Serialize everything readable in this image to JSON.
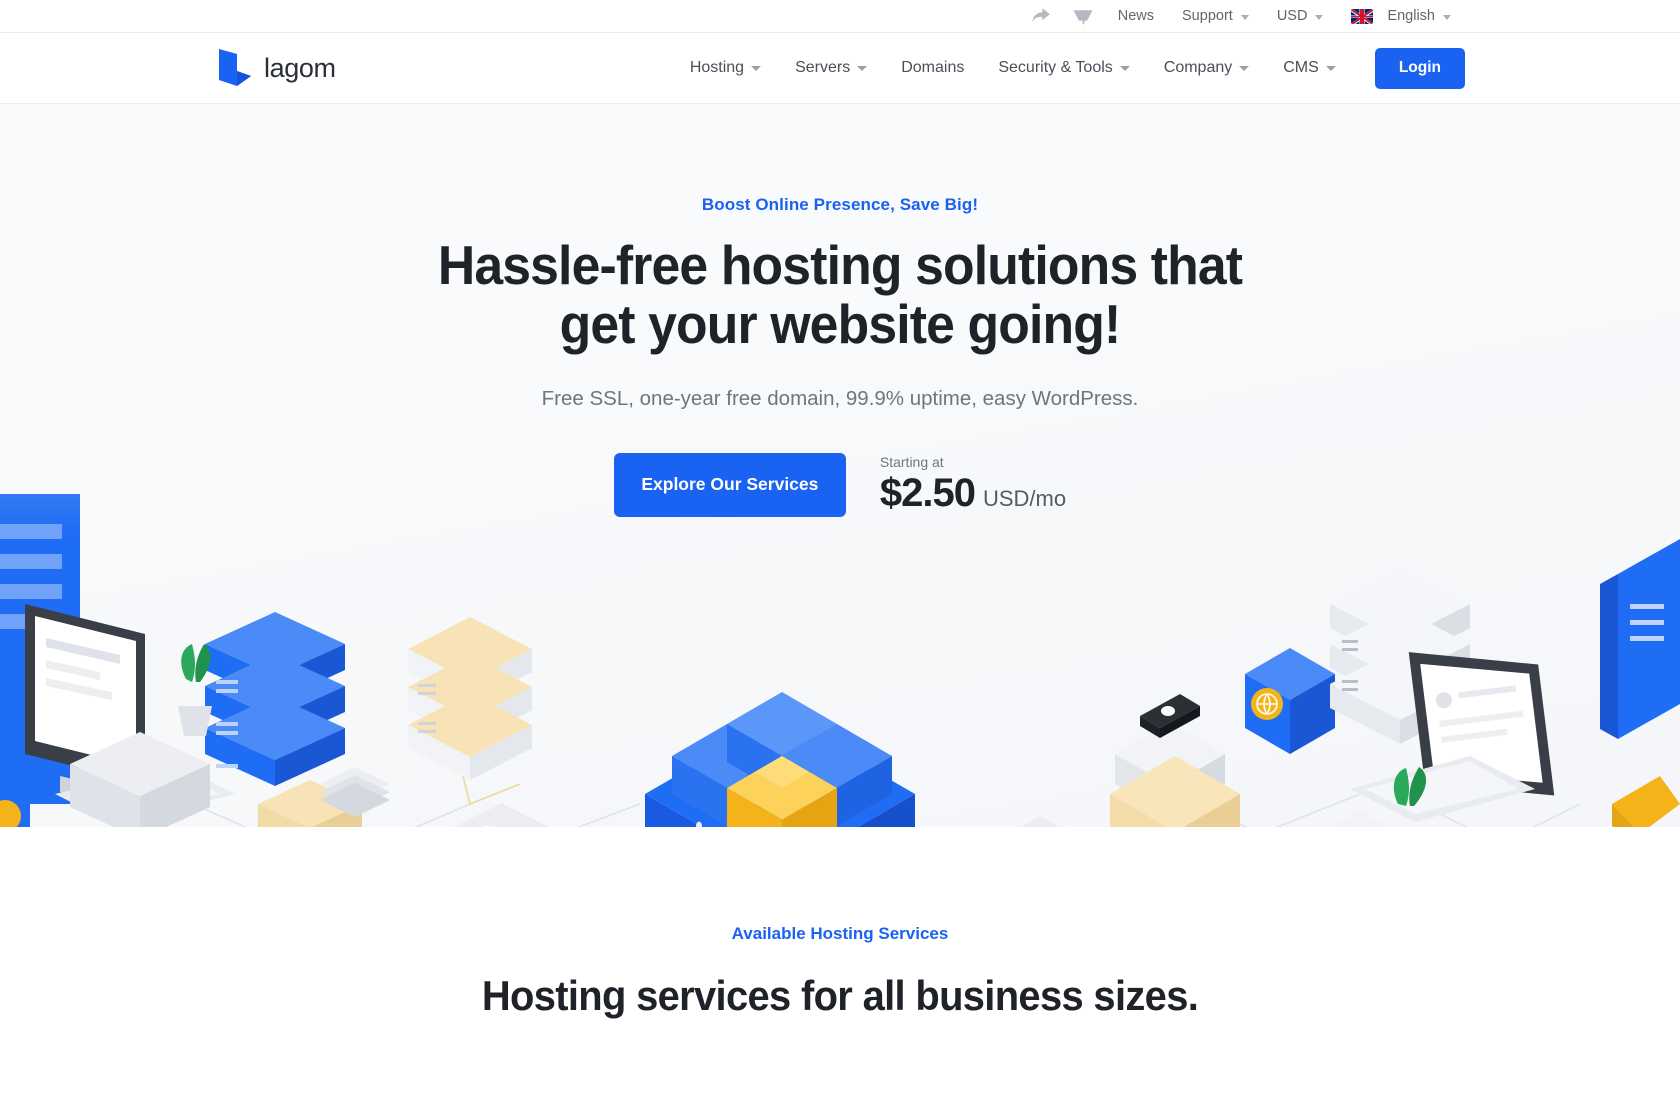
{
  "topbar": {
    "icons": [
      {
        "name": "share-icon",
        "glyph": "share"
      },
      {
        "name": "cart-icon",
        "glyph": "cart"
      }
    ],
    "news_label": "News",
    "support_label": "Support",
    "currency_label": "USD",
    "language_label": "English",
    "flag": "united-kingdom"
  },
  "header": {
    "brand": "lagom",
    "nav": [
      {
        "label": "Hosting",
        "has_dropdown": true
      },
      {
        "label": "Servers",
        "has_dropdown": true
      },
      {
        "label": "Domains",
        "has_dropdown": false
      },
      {
        "label": "Security & Tools",
        "has_dropdown": true
      },
      {
        "label": "Company",
        "has_dropdown": true
      },
      {
        "label": "CMS",
        "has_dropdown": true
      }
    ],
    "login_label": "Login"
  },
  "hero": {
    "eyebrow": "Boost Online Presence, Save Big!",
    "headline_line1": "Hassle-free hosting solutions that",
    "headline_line2": "get your website going!",
    "subhead": "Free SSL, one-year free domain, 99.9% uptime, easy WordPress.",
    "cta_label": "Explore Our Services",
    "price_label": "Starting at",
    "price_amount": "$2.50",
    "price_unit": "USD/mo"
  },
  "section2": {
    "eyebrow": "Available Hosting Services",
    "title": "Hosting services for all business sizes."
  },
  "colors": {
    "accent": "#1a62f2",
    "heading": "#1f2228",
    "muted": "#6f757e",
    "illustration_blue": "#1f6df4",
    "illustration_blue_light": "#4a8bf7",
    "illustration_gold": "#f5b31a",
    "illustration_gray": "#e6e9ee"
  }
}
